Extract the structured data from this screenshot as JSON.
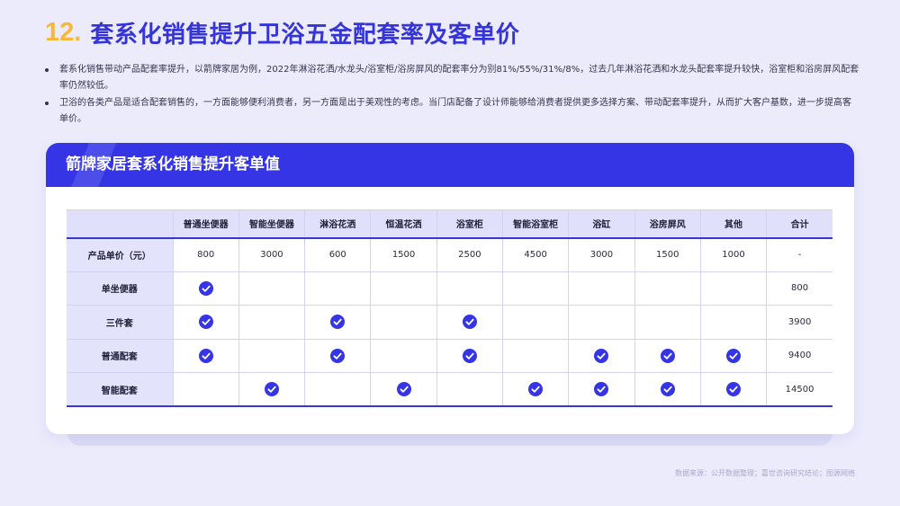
{
  "header": {
    "number": "12.",
    "title": "套系化销售提升卫浴五金配套率及客单价"
  },
  "bullets": [
    "套系化销售带动产品配套率提升，以箭牌家居为例，2022年淋浴花洒/水龙头/浴室柜/浴房屏风的配套率分为别81%/55%/31%/8%，过去几年淋浴花洒和水龙头配套率提升较快，浴室柜和浴房屏风配套率仍然较低。",
    "卫浴的各类产品是适合配套销售的，一方面能够便利消费者，另一方面是出于美观性的考虑。当门店配备了设计师能够给消费者提供更多选择方案、带动配套率提升，从而扩大客户基数，进一步提高客单价。"
  ],
  "card": {
    "title": "箭牌家居套系化销售提升客单值"
  },
  "table": {
    "columns": [
      "普通坐便器",
      "智能坐便器",
      "淋浴花洒",
      "恒温花洒",
      "浴室柜",
      "智能浴室柜",
      "浴缸",
      "浴房屏风",
      "其他",
      "合计"
    ],
    "price_row": {
      "label": "产品单价（元）",
      "values": [
        "800",
        "3000",
        "600",
        "1500",
        "2500",
        "4500",
        "3000",
        "1500",
        "1000",
        "-"
      ]
    },
    "package_rows": [
      {
        "label": "单坐便器",
        "checks": [
          true,
          false,
          false,
          false,
          false,
          false,
          false,
          false,
          false
        ],
        "total": "800"
      },
      {
        "label": "三件套",
        "checks": [
          true,
          false,
          true,
          false,
          true,
          false,
          false,
          false,
          false
        ],
        "total": "3900"
      },
      {
        "label": "普通配套",
        "checks": [
          true,
          false,
          true,
          false,
          true,
          false,
          true,
          true,
          true
        ],
        "total": "9400"
      },
      {
        "label": "智能配套",
        "checks": [
          false,
          true,
          false,
          true,
          false,
          true,
          true,
          true,
          true
        ],
        "total": "14500"
      }
    ]
  },
  "icons": {
    "check": "check-circle-icon"
  },
  "colors": {
    "accent": "#3535e6",
    "number": "#f6b83b",
    "check": "#3535e6"
  },
  "footnote": "数据来源：公开数据整理；嘉世咨询研究结论；图源网络"
}
